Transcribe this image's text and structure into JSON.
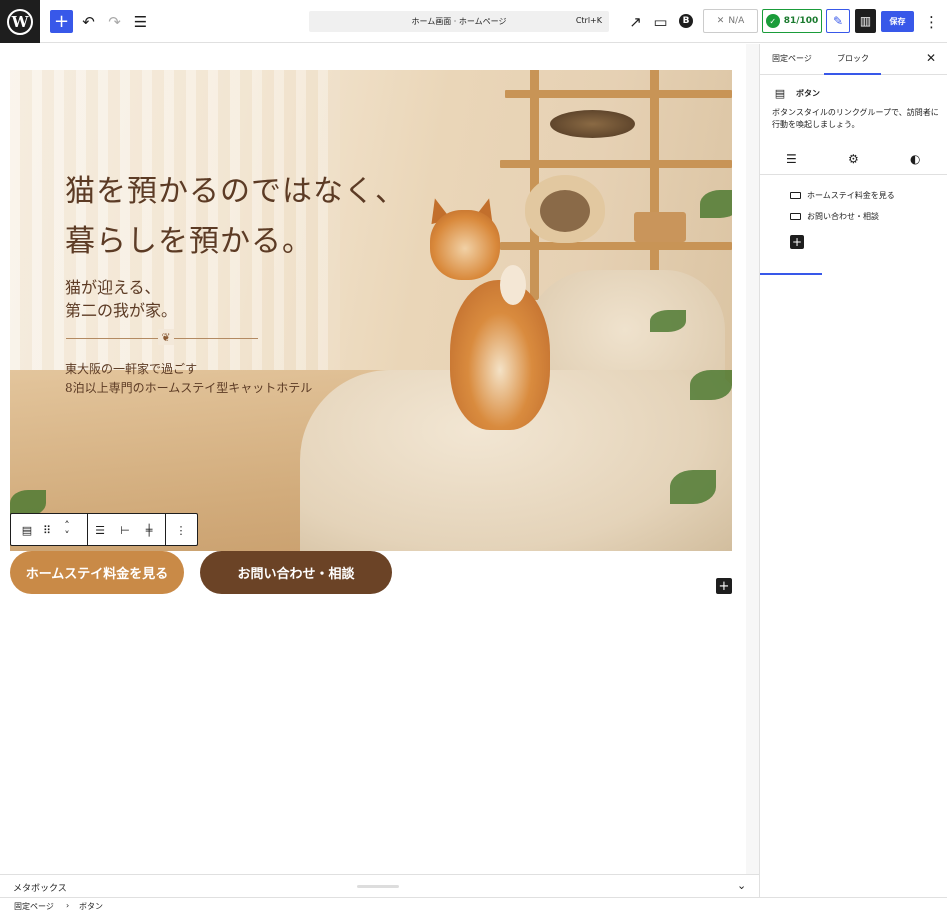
{
  "toolbar": {
    "logo": "W",
    "add": "+",
    "undo": "↶",
    "redo": "↷",
    "list_view": "☰",
    "command_title": "ホーム画面 · ホームページ",
    "command_shortcut": "Ctrl+K",
    "view_external": "↗",
    "device_preview": "▭",
    "seo_badge": "B",
    "na_label": "N/A",
    "score_label": "81/100",
    "ai_icon": "✎",
    "panel_icon": "▥",
    "save_label": "保存",
    "more": "⋮"
  },
  "hero": {
    "title_line1": "猫を預かるのではなく、",
    "title_line2": "暮らしを預かる。",
    "subtitle_line1": "猫が迎える、",
    "subtitle_line2": "第二の我が家。",
    "paw": "❦",
    "desc_line1": "東大阪の一軒家で過ごす",
    "desc_line2": "8泊以上専門のホームステイ型キャットホテル"
  },
  "block_toolbar": {
    "parent": "▤",
    "drag": "⠿",
    "move_up": "˄",
    "move_down": "˅",
    "justify": "☰",
    "align_left": "⊢",
    "align_vertical": "╪",
    "options": "⋮"
  },
  "buttons": {
    "homestay": "ホームステイ料金を見る",
    "contact": "お問い合わせ・相談"
  },
  "canvas_add": "+",
  "metabox": {
    "label": "メタボックス",
    "chevron": "⌄"
  },
  "breadcrumb": {
    "item1": "固定ページ",
    "sep": "›",
    "item2": "ボタン"
  },
  "sidebar": {
    "tab_page": "固定ページ",
    "tab_block": "ブロック",
    "close": "✕",
    "block_icon": "▤",
    "block_name": "ボタン",
    "block_desc": "ボタンスタイルのリンクグループで、訪問者に行動を喚起しましょう。",
    "subtab_list": "☰",
    "subtab_settings": "⚙",
    "subtab_styles": "◐",
    "items": [
      "ホームステイ料金を見る",
      "お問い合わせ・相談"
    ],
    "add": "+"
  },
  "colors": {
    "accent": "#3858e9",
    "button_primary": "#c98a47",
    "button_secondary": "#6b4326",
    "score": "#1a9c3a"
  }
}
